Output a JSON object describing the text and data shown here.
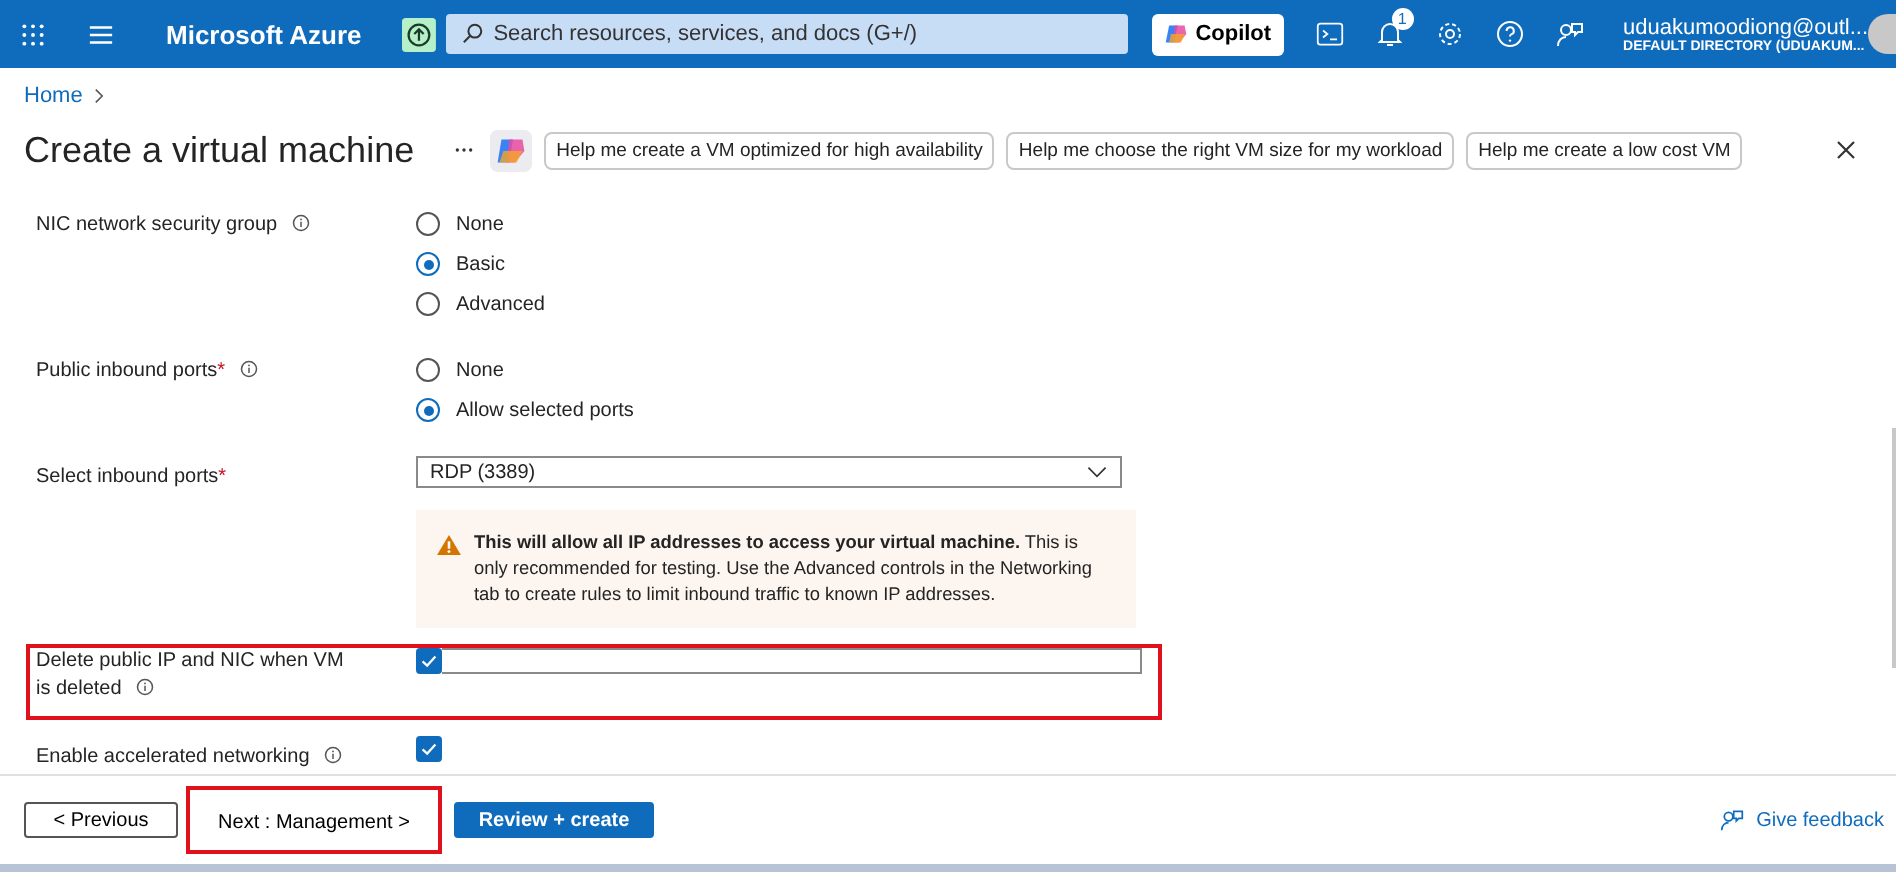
{
  "topbar": {
    "brand": "Microsoft Azure",
    "search": {
      "placeholder": "Search resources, services, and docs (G+/)"
    },
    "copilot": "Copilot",
    "notification_count": "1",
    "user": {
      "name": "uduakumoodiong@outl...",
      "directory": "DEFAULT DIRECTORY (UDUAKUM..."
    }
  },
  "breadcrumb": [
    "Home"
  ],
  "title": "Create a virtual machine",
  "suggestions": [
    "Help me create a VM optimized for high availability",
    "Help me choose the right VM size for my workload",
    "Help me create a low cost VM"
  ],
  "form": {
    "rows": [
      {
        "kind": "radio",
        "label": "NIC network security group",
        "info": true,
        "highlighted": false,
        "options": [
          {
            "label": "None",
            "selected": false
          },
          {
            "label": "Basic",
            "selected": true
          },
          {
            "label": "Advanced",
            "selected": false
          }
        ]
      },
      {
        "kind": "radio",
        "label": "Public inbound ports",
        "required_mark": "*",
        "info": true,
        "highlighted": false,
        "options": [
          {
            "label": "None",
            "selected": false
          },
          {
            "label": "Allow selected ports",
            "selected": true
          }
        ]
      },
      {
        "kind": "dropdown",
        "label": "Select inbound ports",
        "required_mark": "*",
        "highlighted": false,
        "value": "RDP (3389)"
      },
      {
        "kind": "warning",
        "bold": "This will allow all IP addresses to access your virtual machine.",
        "text": "This is only recommended for testing.  Use the Advanced controls in the Networking tab to create rules to limit inbound traffic to known IP addresses."
      },
      {
        "kind": "checkbox",
        "label": "Delete public IP and NIC when VM is deleted",
        "info": true,
        "highlighted": true,
        "checked": true,
        "field": true
      },
      {
        "kind": "checkbox",
        "label": "Enable accelerated networking",
        "info": true,
        "highlighted": false,
        "checked": true,
        "field": false
      }
    ]
  },
  "footer": {
    "buttons": [
      {
        "kind": "secondary",
        "label": "< Previous",
        "highlighted": false
      },
      {
        "kind": "secondary",
        "label": "Next : Management >",
        "highlighted": true
      },
      {
        "kind": "primary",
        "label": "Review + create",
        "highlighted": false
      }
    ],
    "feedback": "Give feedback"
  }
}
